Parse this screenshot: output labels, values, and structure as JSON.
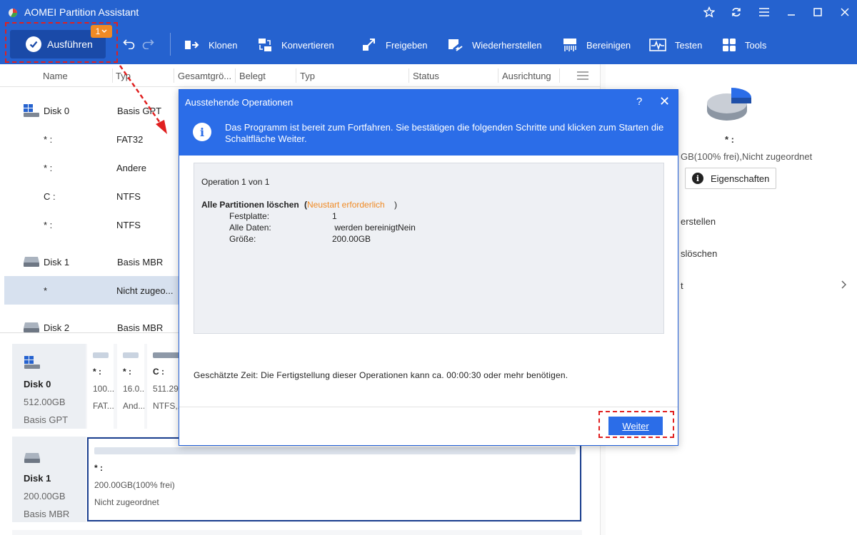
{
  "app": {
    "title": "AOMEI Partition Assistant"
  },
  "toolbar": {
    "execute_label": "Ausführen",
    "execute_badge": "1",
    "tools": [
      {
        "label": "Klonen",
        "icon": "clone-icon"
      },
      {
        "label": "Konvertieren",
        "icon": "convert-icon"
      },
      {
        "label": "Freigeben",
        "icon": "free-up-icon"
      },
      {
        "label": "Wiederherstellen",
        "icon": "recover-icon"
      },
      {
        "label": "Bereinigen",
        "icon": "wipe-icon"
      },
      {
        "label": "Testen",
        "icon": "test-icon"
      },
      {
        "label": "Tools",
        "icon": "tools-icon"
      }
    ]
  },
  "list": {
    "columns": [
      "Name",
      "Typ",
      "Gesamtgrö...",
      "Belegt",
      "Typ",
      "Status",
      "Ausrichtung"
    ],
    "rows": [
      {
        "name": "Disk 0",
        "type": "Basis GPT"
      },
      {
        "name": "* :",
        "type": "FAT32"
      },
      {
        "name": "* :",
        "type": "Andere"
      },
      {
        "name": "C :",
        "type": "NTFS"
      },
      {
        "name": "* :",
        "type": "NTFS"
      },
      {
        "name": "Disk 1",
        "type": "Basis MBR"
      },
      {
        "name": "*",
        "type": "Nicht zugeo..."
      },
      {
        "name": "Disk 2",
        "type": "Basis MBR"
      }
    ]
  },
  "diskmap": {
    "disk0": {
      "name": "Disk 0",
      "size": "512.00GB",
      "type": "Basis GPT",
      "segments": [
        {
          "label": "* :",
          "size": "100....",
          "fs": "FAT..."
        },
        {
          "label": "* :",
          "size": "16.0...",
          "fs": "And..."
        },
        {
          "label": "C :",
          "size": "511.29...",
          "fs": "NTFS,..."
        }
      ]
    },
    "disk1": {
      "name": "Disk 1",
      "size": "200.00GB",
      "type": "Basis MBR",
      "segment": {
        "label": "* :",
        "size": "200.00GB(100% frei)",
        "fs": "Nicht zugeordnet"
      }
    }
  },
  "right_pane": {
    "drive_label": "* :",
    "drive_info": "GB(100% frei),Nicht zugeordnet",
    "properties_label": "Eigenschaften",
    "menu": [
      "erstellen",
      "slöschen",
      "t"
    ]
  },
  "dialog": {
    "title": "Ausstehende Operationen",
    "info": "Das Programm ist bereit zum Fortfahren. Sie bestätigen die folgenden Schritte und klicken zum Starten die Schaltfläche Weiter.",
    "op_counter": "Operation 1 von 1",
    "op_title": "Alle Partitionen löschen",
    "op_note_open": "(",
    "op_note": "Neustart erforderlich",
    "op_note_close": ")",
    "details": [
      {
        "key": "Festplatte:",
        "value": "1"
      },
      {
        "key": "Alle Daten:",
        "value": " werden bereinigtNein"
      },
      {
        "key": "Größe:",
        "value": "200.00GB"
      }
    ],
    "estimate": "Geschätzte Zeit: Die Fertigstellung dieser Operationen kann ca. 00:00:30 oder mehr benötigen.",
    "next_label": "Weiter"
  },
  "colors": {
    "brand": "#2562cf",
    "dialog_header": "#2b6de8",
    "warning": "#f08a24",
    "highlight_dash": "#e02020"
  }
}
